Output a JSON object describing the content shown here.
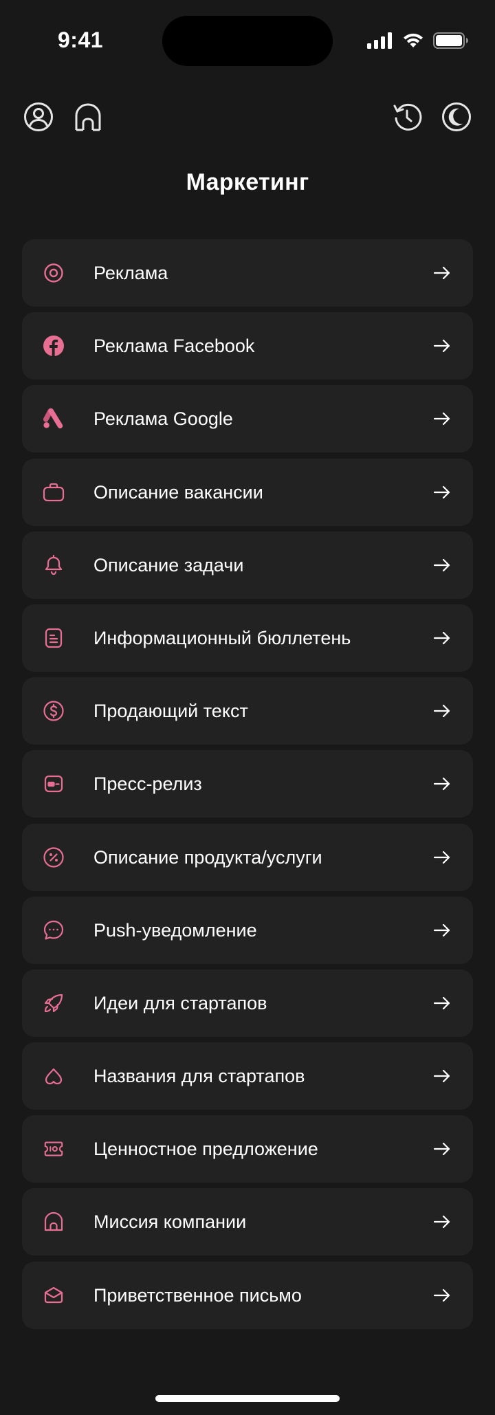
{
  "status_bar": {
    "time": "9:41"
  },
  "header": {
    "title": "Маркетинг"
  },
  "colors": {
    "background": "#181818",
    "card": "#222223",
    "accent": "#e86e94",
    "text": "#ffffff"
  },
  "items": [
    {
      "label": "Реклама",
      "icon": "target-icon"
    },
    {
      "label": "Реклама Facebook",
      "icon": "facebook-icon"
    },
    {
      "label": "Реклама Google",
      "icon": "google-ads-icon"
    },
    {
      "label": "Описание вакансии",
      "icon": "briefcase-icon"
    },
    {
      "label": "Описание задачи",
      "icon": "task-bell-icon"
    },
    {
      "label": "Информационный бюллетень",
      "icon": "newsletter-icon"
    },
    {
      "label": "Продающий текст",
      "icon": "dollar-icon"
    },
    {
      "label": "Пресс-релиз",
      "icon": "press-card-icon"
    },
    {
      "label": "Описание продукта/услуги",
      "icon": "percent-icon"
    },
    {
      "label": "Push-уведомление",
      "icon": "chat-bubble-icon"
    },
    {
      "label": "Идеи для стартапов",
      "icon": "rocket-icon"
    },
    {
      "label": "Названия для стартапов",
      "icon": "heart-icon"
    },
    {
      "label": "Ценностное предложение",
      "icon": "ticket-icon"
    },
    {
      "label": "Миссия компании",
      "icon": "house-icon"
    },
    {
      "label": "Приветственное письмо",
      "icon": "mail-icon"
    }
  ]
}
